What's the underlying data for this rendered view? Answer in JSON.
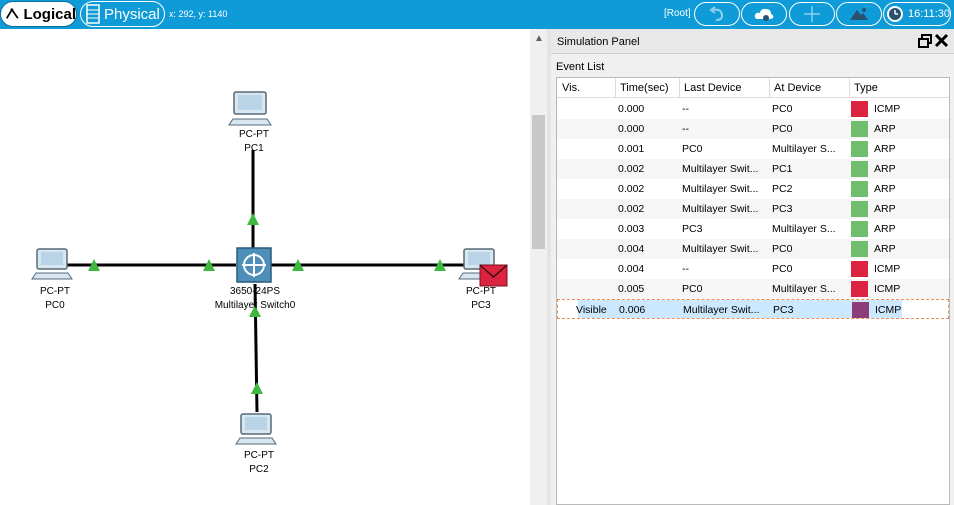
{
  "topbar": {
    "tabs": {
      "logical": "Logical",
      "physical": "Physical"
    },
    "coords": "x: 292, y: 1140",
    "root": "[Root]",
    "clock": "16:11:30"
  },
  "panel": {
    "title": "Simulation Panel",
    "event_list_label": "Event List",
    "columns": [
      "Vis.",
      "Time(sec)",
      "Last Device",
      "At Device",
      "Type"
    ],
    "events": [
      {
        "vis": "",
        "time": "0.000",
        "last": "--",
        "at": "PC0",
        "type": "ICMP",
        "color": "#dc2340"
      },
      {
        "vis": "",
        "time": "0.000",
        "last": "--",
        "at": "PC0",
        "type": "ARP",
        "color": "#6ebe6e"
      },
      {
        "vis": "",
        "time": "0.001",
        "last": "PC0",
        "at": "Multilayer S...",
        "type": "ARP",
        "color": "#6ebe6e"
      },
      {
        "vis": "",
        "time": "0.002",
        "last": "Multilayer Swit...",
        "at": "PC1",
        "type": "ARP",
        "color": "#6ebe6e"
      },
      {
        "vis": "",
        "time": "0.002",
        "last": "Multilayer Swit...",
        "at": "PC2",
        "type": "ARP",
        "color": "#6ebe6e"
      },
      {
        "vis": "",
        "time": "0.002",
        "last": "Multilayer Swit...",
        "at": "PC3",
        "type": "ARP",
        "color": "#6ebe6e"
      },
      {
        "vis": "",
        "time": "0.003",
        "last": "PC3",
        "at": "Multilayer S...",
        "type": "ARP",
        "color": "#6ebe6e"
      },
      {
        "vis": "",
        "time": "0.004",
        "last": "Multilayer Swit...",
        "at": "PC0",
        "type": "ARP",
        "color": "#6ebe6e"
      },
      {
        "vis": "",
        "time": "0.004",
        "last": "--",
        "at": "PC0",
        "type": "ICMP",
        "color": "#dc2340"
      },
      {
        "vis": "",
        "time": "0.005",
        "last": "PC0",
        "at": "Multilayer S...",
        "type": "ICMP",
        "color": "#dc2340"
      },
      {
        "vis": "Visible",
        "time": "0.006",
        "last": "Multilayer Swit...",
        "at": "PC3",
        "type": "ICMP",
        "color": "#8c3c78",
        "selected": true
      }
    ]
  },
  "topology": {
    "pc1": {
      "model": "PC-PT",
      "name": "PC1"
    },
    "pc0": {
      "model": "PC-PT",
      "name": "PC0"
    },
    "pc3": {
      "model": "PC-PT",
      "name": "PC3"
    },
    "pc2": {
      "model": "PC-PT",
      "name": "PC2"
    },
    "switch": {
      "model": "3650-24PS",
      "name": "Multilayer Switch0"
    }
  }
}
